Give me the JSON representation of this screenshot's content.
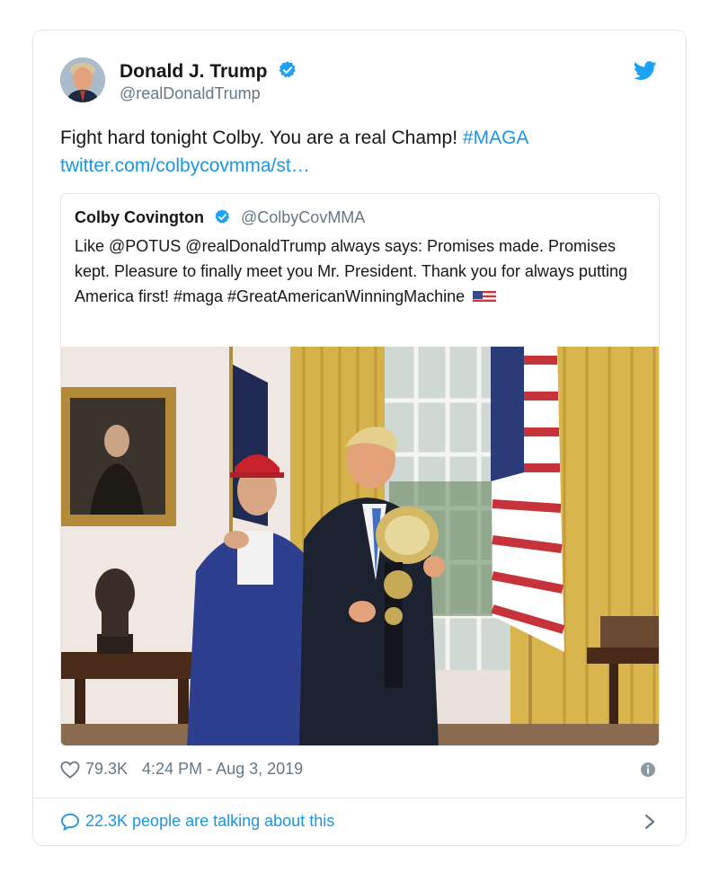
{
  "tweet": {
    "author_name": "Donald J. Trump",
    "author_handle": "@realDonaldTrump",
    "text_main": "Fight hard tonight Colby. You are a real Champ!",
    "hashtag": "#MAGA",
    "link": "twitter.com/colbycovmma/st…",
    "likes": "79.3K",
    "timestamp": "4:24 PM - Aug 3, 2019",
    "conversation": "22.3K people are talking about this"
  },
  "quoted": {
    "author_name": "Colby Covington",
    "author_handle": "@ColbyCovMMA",
    "text": "Like @POTUS @realDonaldTrump always says: Promises made. Promises kept. Pleasure to finally meet you Mr. President. Thank you for always putting America first! #maga #GreatAmericanWinningMachine"
  },
  "icons": {
    "verified": "verified-badge-icon",
    "bird": "twitter-bird-icon",
    "heart": "heart-icon",
    "info": "info-icon",
    "reply": "speech-bubble-icon",
    "chevron": "chevron-right-icon"
  },
  "colors": {
    "accent": "#1b95e0",
    "muted": "#657786",
    "border": "#e1e8ed",
    "text": "#14171a"
  }
}
